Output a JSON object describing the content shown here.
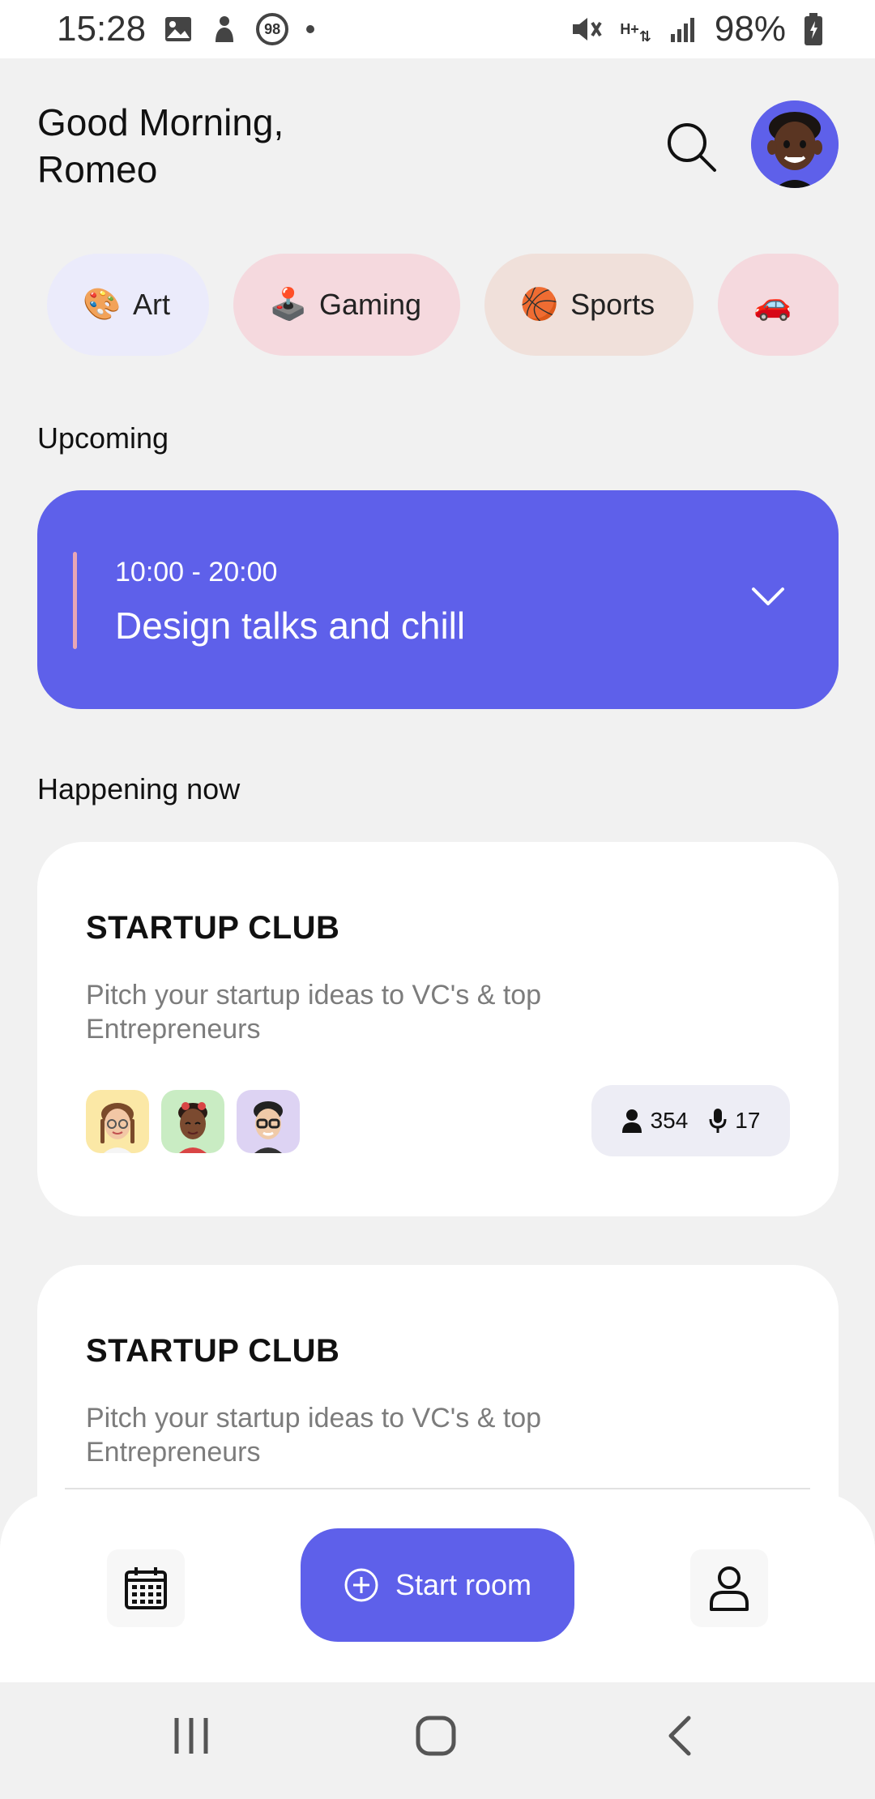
{
  "status_bar": {
    "time": "15:28",
    "notif_badge": "98",
    "network_label": "H+",
    "battery": "98%"
  },
  "header": {
    "greeting_line1": "Good Morning,",
    "greeting_line2": "Romeo"
  },
  "categories": [
    {
      "emoji": "🎨",
      "label": "Art",
      "color": "#ebebfb"
    },
    {
      "emoji": "🕹️",
      "label": "Gaming",
      "color": "#f5d9de"
    },
    {
      "emoji": "🏀",
      "label": "Sports",
      "color": "#f0e0da"
    },
    {
      "emoji": "🚗",
      "label": "",
      "color": "#f5d9de"
    }
  ],
  "upcoming": {
    "section_label": "Upcoming",
    "time": "10:00 - 20:00",
    "title": "Design talks and chill"
  },
  "happening_now": {
    "section_label": "Happening now",
    "rooms": [
      {
        "title": "STARTUP CLUB",
        "description": "Pitch your startup ideas to VC's & top Entrepreneurs",
        "listeners": "354",
        "speakers": "17"
      },
      {
        "title": "STARTUP CLUB",
        "description": "Pitch your startup ideas to VC's & top Entrepreneurs"
      }
    ]
  },
  "bottom_nav": {
    "start_room_label": "Start room"
  },
  "colors": {
    "accent": "#5e60ea",
    "background": "#f1f1f1"
  }
}
